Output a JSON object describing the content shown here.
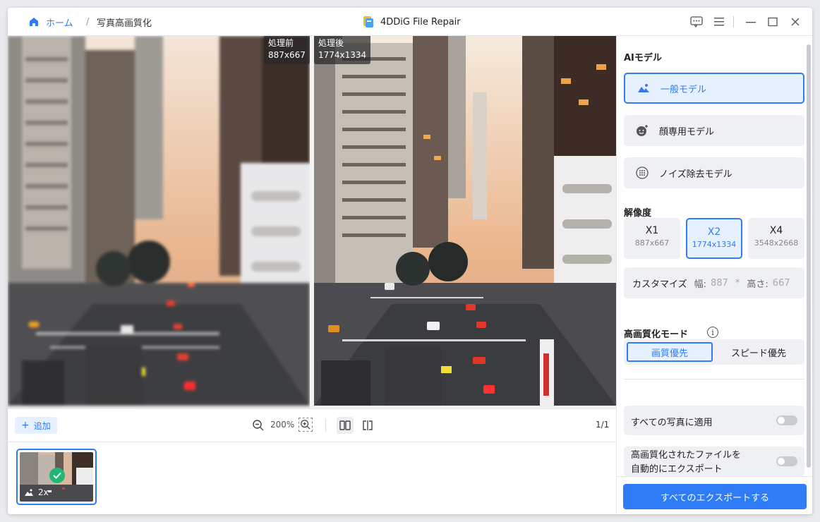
{
  "titlebar": {
    "home_label": "ホーム",
    "separator": "/",
    "current": "写真高画質化",
    "app_title": "4DDiG File Repair",
    "feedback_icon": "chat-icon",
    "menu_icon": "hamburger-icon",
    "minimize_icon": "minimize-icon",
    "maximize_icon": "maximize-icon",
    "close_icon": "close-icon"
  },
  "preview": {
    "before_label": "処理前",
    "before_size": "887x667",
    "after_label": "処理後",
    "after_size": "1774x1334"
  },
  "toolbar": {
    "add_label": "追加",
    "zoom_level": "200%",
    "page_count": "1/1"
  },
  "thumbnail": {
    "scale_label": "2x",
    "status": "done"
  },
  "panel": {
    "ai_model_title": "AIモデル",
    "models": [
      {
        "label": "一般モデル",
        "active": true
      },
      {
        "label": "顔専用モデル",
        "active": false
      },
      {
        "label": "ノイズ除去モデル",
        "active": false
      }
    ],
    "resolution_title": "解像度",
    "resolutions": [
      {
        "name": "X1",
        "size": "887x667"
      },
      {
        "name": "X2",
        "size": "1774x1334"
      },
      {
        "name": "X4",
        "size": "3548x2668"
      }
    ],
    "custom": {
      "label": "カスタマイズ",
      "width_label": "幅:",
      "width_value": "887",
      "times": "*",
      "height_label": "高さ:",
      "height_value": "667"
    },
    "mode_title": "高画質化モード",
    "modes": [
      "画質優先",
      "スピード優先"
    ],
    "apply_all_label": "すべての写真に適用",
    "auto_export_line1": "高画質化されたファイルを",
    "auto_export_line2": "自動的にエクスポート",
    "export_button": "すべてのエクスポートする"
  },
  "colors": {
    "accent": "#2f7cf6",
    "check": "#23b573"
  }
}
